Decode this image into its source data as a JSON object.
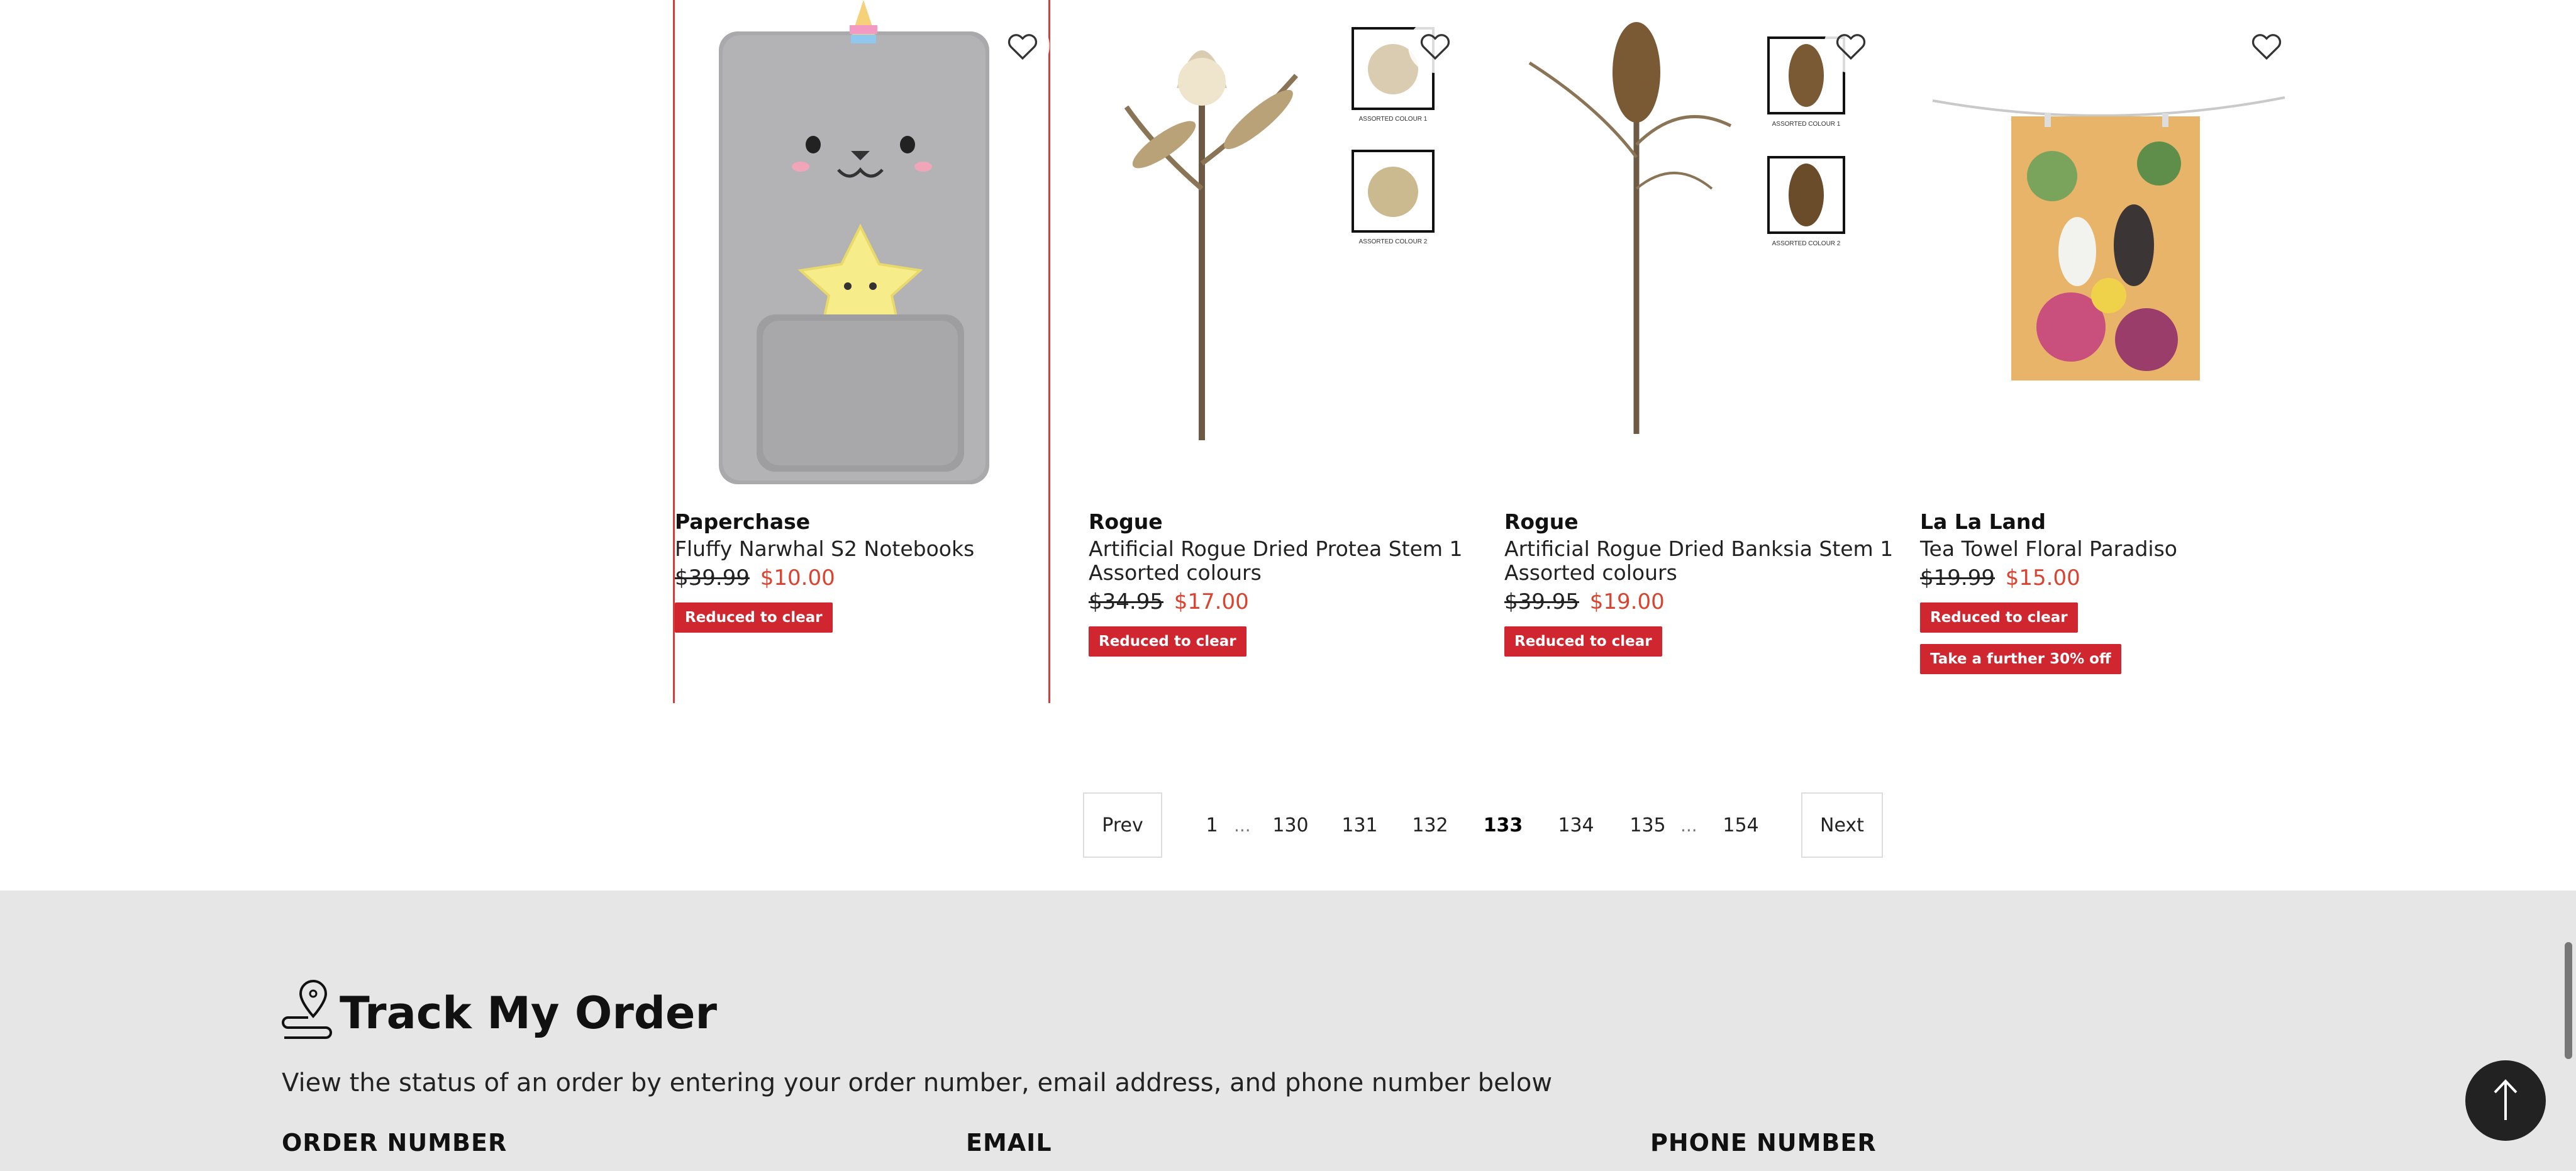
{
  "products": [
    {
      "brand": "Paperchase",
      "name": "Fluffy Narwhal S2 Notebooks",
      "was_price": "$39.99",
      "now_price": "$10.00",
      "badges": [
        "Reduced to clear"
      ],
      "image": "plush-narwhal-notebook"
    },
    {
      "brand": "Rogue",
      "name": "Artificial Rogue Dried Protea Stem 1 Assorted colours",
      "was_price": "$34.95",
      "now_price": "$17.00",
      "badges": [
        "Reduced to clear"
      ],
      "image": "dried-protea-stem",
      "swatch_labels": [
        "ASSORTED COLOUR 1",
        "ASSORTED COLOUR 2"
      ]
    },
    {
      "brand": "Rogue",
      "name": "Artificial Rogue Dried Banksia Stem 1 Assorted colours",
      "was_price": "$39.95",
      "now_price": "$19.00",
      "badges": [
        "Reduced to clear"
      ],
      "image": "dried-banksia-stem",
      "swatch_labels": [
        "ASSORTED COLOUR 1",
        "ASSORTED COLOUR 2"
      ]
    },
    {
      "brand": "La La Land",
      "name": "Tea Towel Floral Paradiso",
      "was_price": "$19.99",
      "now_price": "$15.00",
      "badges": [
        "Reduced to clear",
        "Take a further 30% off"
      ],
      "image": "floral-tea-towel"
    }
  ],
  "pagination": {
    "prev": "Prev",
    "next": "Next",
    "pages": [
      "1",
      "130",
      "131",
      "132",
      "133",
      "134",
      "135",
      "154"
    ],
    "current": "133",
    "ellipsis": "..."
  },
  "track_order": {
    "title": "Track My Order",
    "description": "View the status of an order by entering your order number, email address, and phone number below",
    "fields": [
      "ORDER NUMBER",
      "EMAIL",
      "PHONE NUMBER"
    ]
  },
  "icons": {
    "wishlist": "heart-outline-icon",
    "track": "location-pin-icon",
    "back_to_top": "arrow-up-icon"
  },
  "colors": {
    "sale_price": "#d9432f",
    "badge_bg": "#d0262f",
    "footer_bg": "#e6e6e6",
    "active_border": "#d63c3c"
  }
}
